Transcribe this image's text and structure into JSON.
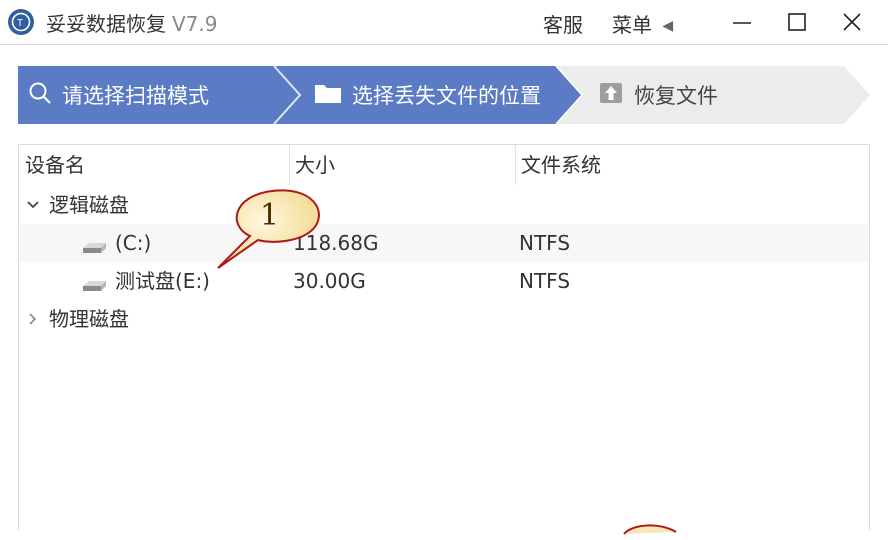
{
  "app": {
    "title": "妥妥数据恢复",
    "version": "V7.9"
  },
  "titlebar": {
    "service_label": "客服",
    "menu_label": "菜单",
    "menu_arrow": "◀"
  },
  "steps": [
    {
      "label": "请选择扫描模式",
      "icon": "search-icon"
    },
    {
      "label": "选择丢失文件的位置",
      "icon": "folder-icon"
    },
    {
      "label": "恢复文件",
      "icon": "restore-upload-icon"
    }
  ],
  "table": {
    "columns": [
      "设备名",
      "大小",
      "文件系统"
    ],
    "groups": [
      {
        "label": "逻辑磁盘",
        "expanded": true,
        "items": [
          {
            "name": "(C:)",
            "size": "118.68G",
            "fs": "NTFS"
          },
          {
            "name": "测试盘(E:)",
            "size": "30.00G",
            "fs": "NTFS"
          }
        ]
      },
      {
        "label": "物理磁盘",
        "expanded": false,
        "items": []
      }
    ]
  },
  "callout": {
    "number": "1"
  },
  "colors": {
    "step_active": "#5b7cc4",
    "step_inactive": "#ececec",
    "app_icon": "#2f5f9e",
    "callout_fill": "#f6e7b9"
  }
}
